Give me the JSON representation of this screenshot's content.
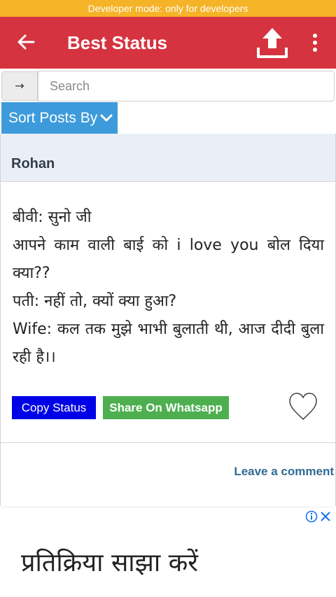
{
  "system": {
    "dev_banner": "Developer mode: only for developers"
  },
  "appbar": {
    "title": "Best Status",
    "back_icon": "back-arrow-icon",
    "upload_icon": "upload-icon",
    "more_icon": "more-vert-icon",
    "color": "#d5333f"
  },
  "search": {
    "go_label": "→",
    "placeholder": "Search",
    "value": ""
  },
  "sort": {
    "label": "Sort Posts By",
    "icon": "chevron-down-icon"
  },
  "post": {
    "author": "Rohan",
    "lines": [
      "बीवी: सुनो जी",
      "आपने काम वाली बाई को i love you बोल दिया क्या??",
      "पती: नहीं तो, क्यों क्या हुआ?",
      "Wife: कल तक मुझे भाभी बुलाती थी, आज दीदी बुला रही है।।"
    ],
    "copy_label": "Copy Status",
    "share_label": "Share On Whatsapp",
    "like_icon": "heart-outline-icon",
    "liked": false
  },
  "comments": {
    "leave_label": "Leave a comment"
  },
  "ad": {
    "text": "प्रतिक्रिया साझा करें",
    "info_icon": "info-icon",
    "close_icon": "close-icon"
  }
}
